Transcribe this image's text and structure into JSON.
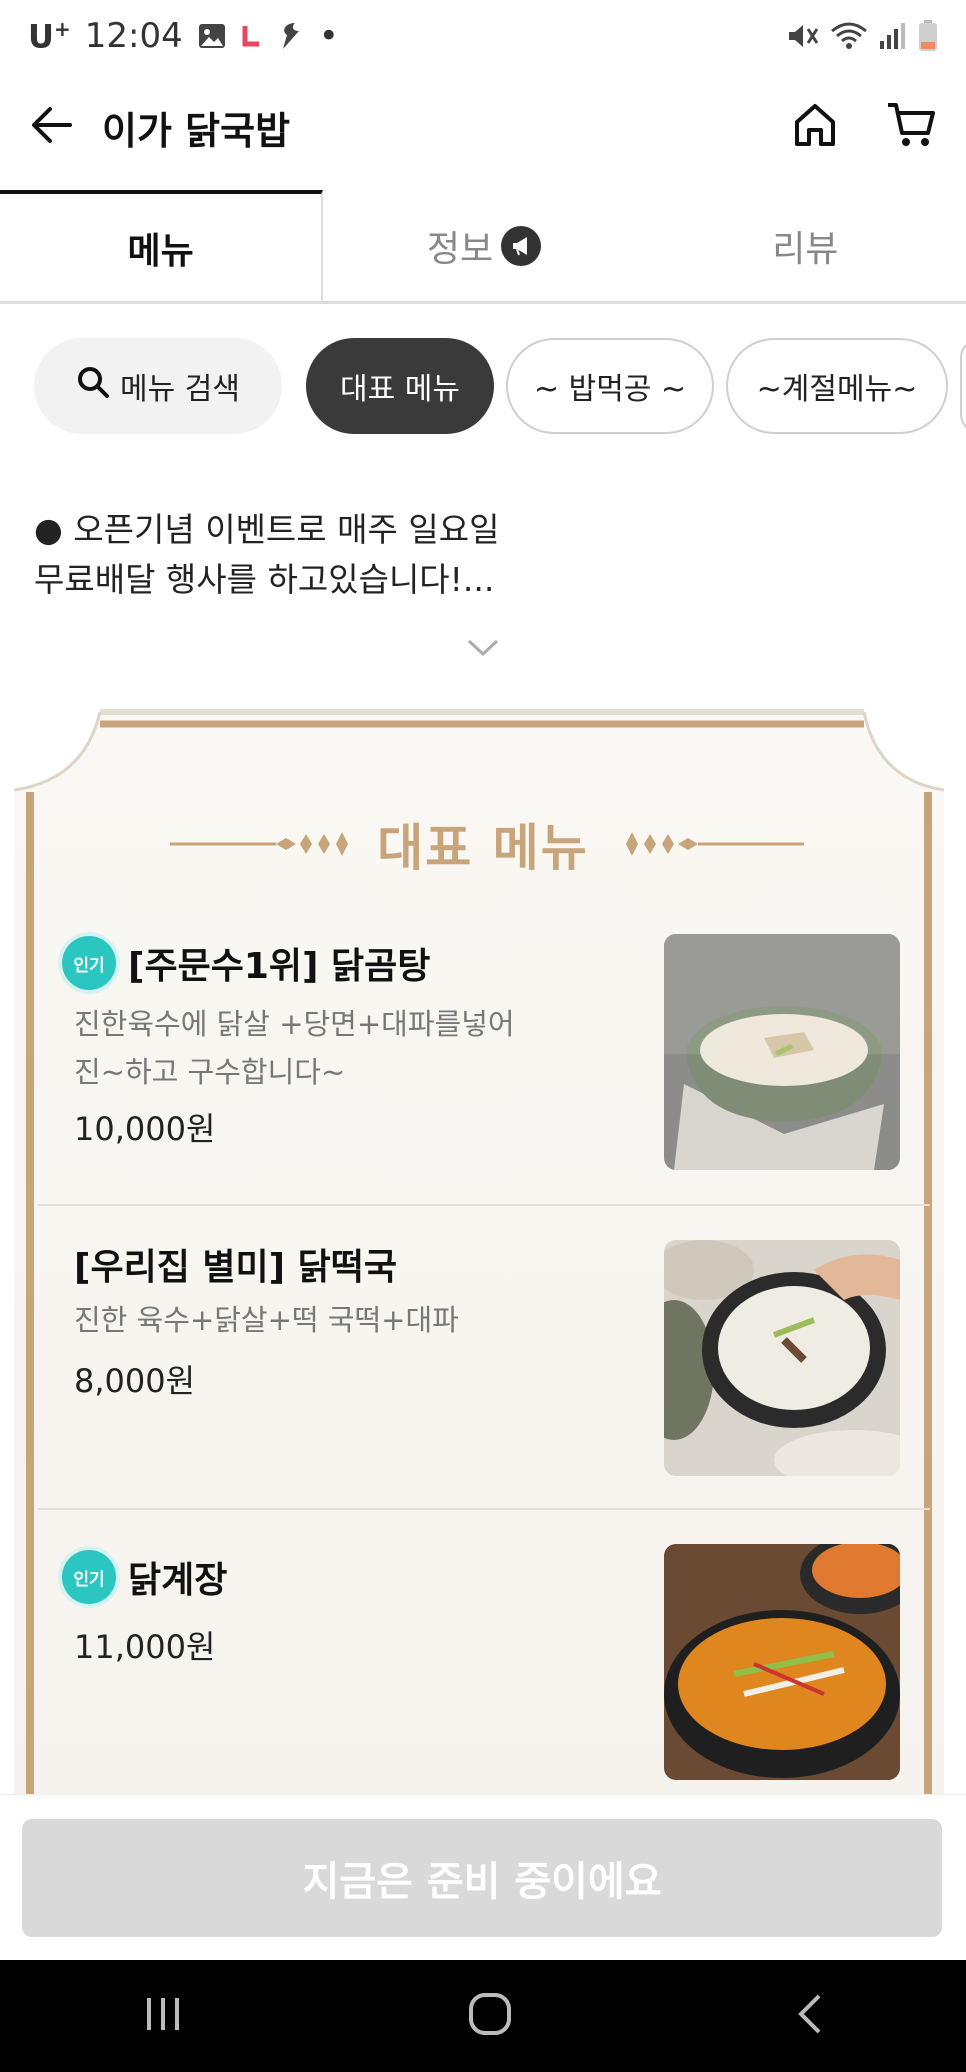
{
  "status_bar": {
    "carrier": "U",
    "time": "12:04",
    "dot": "•"
  },
  "header": {
    "title": "이가 닭국밥"
  },
  "tabs": [
    {
      "label": "메뉴"
    },
    {
      "label": "정보"
    },
    {
      "label": "리뷰"
    }
  ],
  "chips": {
    "search_label": "메뉴 검색",
    "items": [
      {
        "label": "대표 메뉴"
      },
      {
        "label": "~ 밥먹공 ~"
      },
      {
        "label": "~계절메뉴~"
      }
    ]
  },
  "notice": {
    "line1": "● 오픈기념 이벤트로 매주 일요일",
    "line2": "무료배달 행사를 하고있습니다!..."
  },
  "section": {
    "title": "대표 메뉴"
  },
  "menu_items": [
    {
      "badge": "인기",
      "name": "[주문수1위] 닭곰탕",
      "desc_line1": "진한육수에 닭살 +당면+대파를넣어",
      "desc_line2": "진~하고 구수합니다~",
      "price": "10,000원"
    },
    {
      "name": "[우리집 별미] 닭떡국",
      "desc_line1": "진한 육수+닭살+떡 국떡+대파",
      "price": "8,000원"
    },
    {
      "badge": "인기",
      "name": "닭계장",
      "price": "11,000원"
    }
  ],
  "cta": {
    "label": "지금은 준비 중이에요"
  },
  "colors": {
    "accent_gold": "#c7a47a",
    "badge_teal": "#2cc6c1",
    "chip_active": "#3a3a3a"
  }
}
